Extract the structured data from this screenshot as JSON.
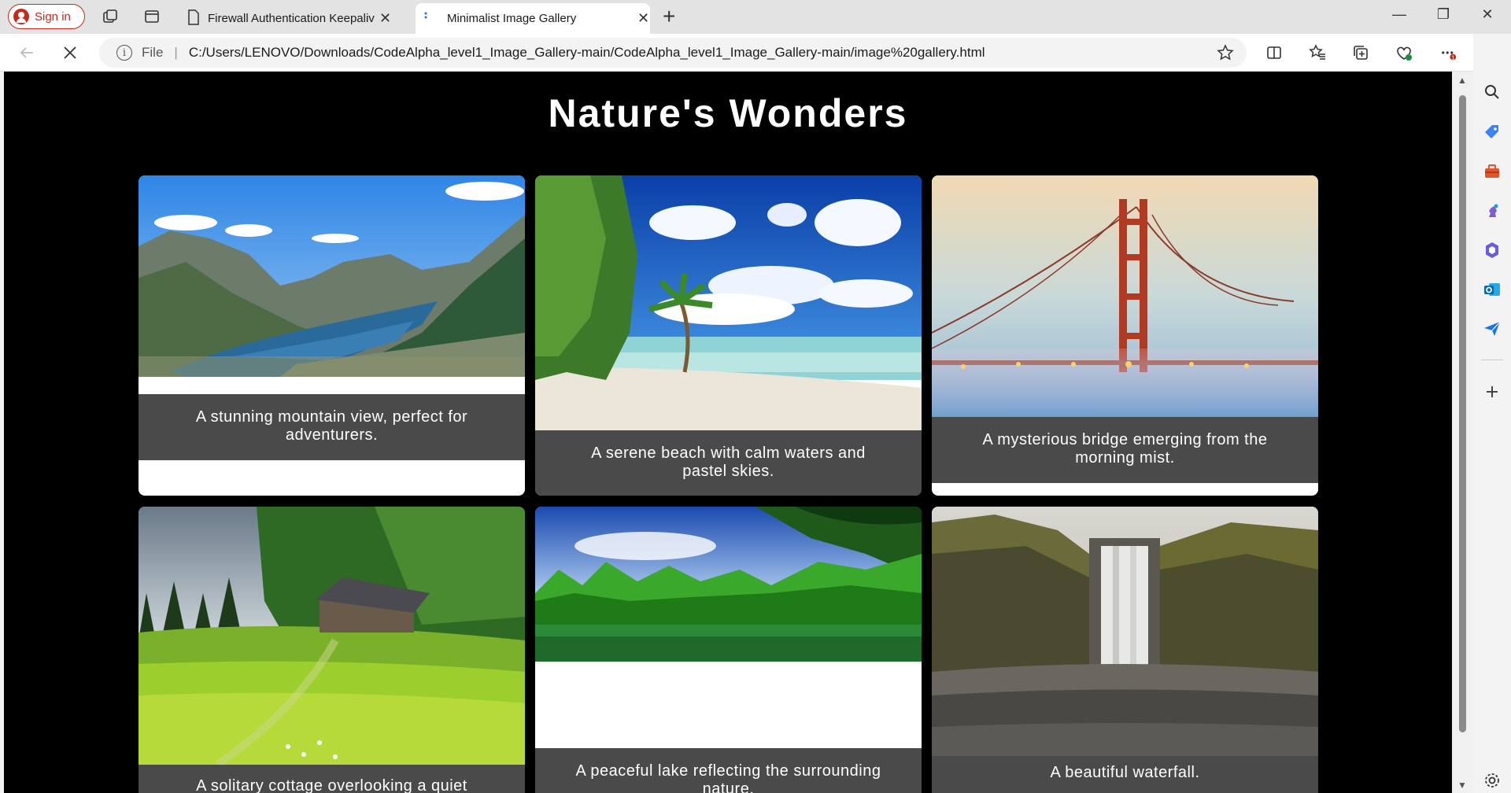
{
  "browser": {
    "sign_in_label": "Sign in",
    "tabs": [
      {
        "title": "Firewall Authentication Keepalive",
        "icon": "page-icon"
      },
      {
        "title": "Minimalist Image Gallery",
        "icon": "loading-icon"
      }
    ],
    "address": {
      "scheme_label": "File",
      "url": "C:/Users/LENOVO/Downloads/CodeAlpha_level1_Image_Gallery-main/CodeAlpha_level1_Image_Gallery-main/image%20gallery.html"
    },
    "notification_badge": "1",
    "accent_color": "#c42b1c"
  },
  "page": {
    "title": "Nature's Wonders",
    "background": "#000000",
    "gallery": [
      {
        "caption": "A stunning mountain view, perfect for adventurers.",
        "image": "mountain-lake"
      },
      {
        "caption": "A serene beach with calm waters and pastel skies.",
        "image": "tropical-beach"
      },
      {
        "caption": "A mysterious bridge emerging from the morning mist.",
        "image": "golden-gate-bridge-fog"
      },
      {
        "caption": "A solitary cottage overlooking a quiet",
        "image": "meadow-cabin"
      },
      {
        "caption": "A peaceful lake reflecting the surrounding nature.",
        "image": "forest-lake"
      },
      {
        "caption": "A beautiful waterfall.",
        "image": "waterfall"
      }
    ]
  }
}
